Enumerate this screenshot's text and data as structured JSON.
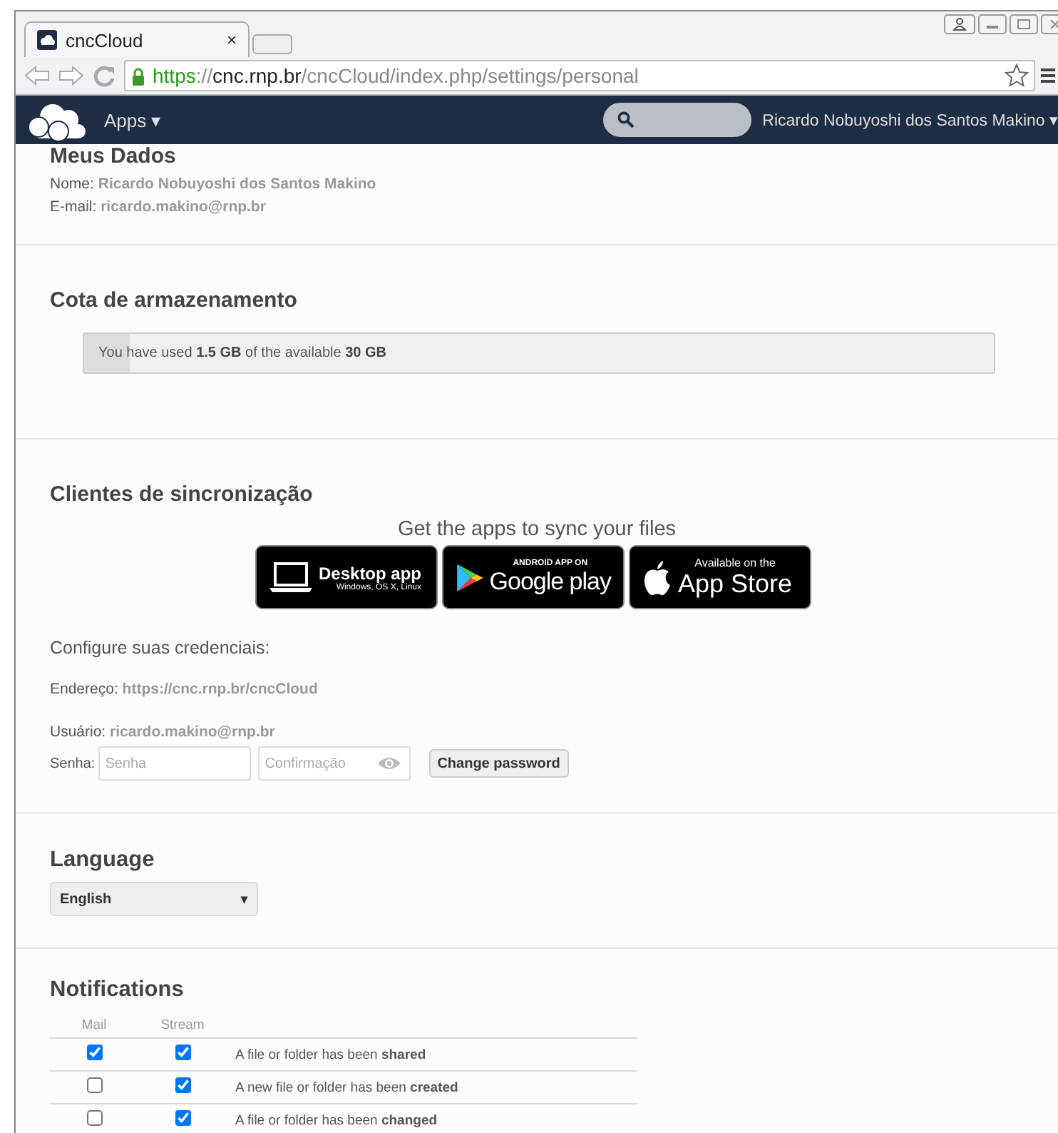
{
  "browser": {
    "tab": {
      "title": "cncCloud",
      "close": "×"
    },
    "url": {
      "scheme": "https",
      "separator": "://",
      "host": "cnc.rnp.br",
      "path": "/cncCloud/index.php/settings/personal"
    }
  },
  "header": {
    "apps": "Apps ▾",
    "user": "Ricardo Nobuyoshi dos Santos Makino ▾"
  },
  "personal": {
    "title": "Meus Dados",
    "fields": [
      {
        "label": "Nome:",
        "value": "Ricardo Nobuyoshi dos Santos Makino"
      },
      {
        "label": "E-mail:",
        "value": "ricardo.makino@rnp.br"
      }
    ]
  },
  "quota": {
    "title": "Cota de armazenamento",
    "text": "You have used **1.5 GB** of the available **30 GB**",
    "level": 0.05
  },
  "sync": {
    "title": "Clientes de sincronização",
    "subtitle": "Get the apps to sync your files",
    "badges": [
      {
        "kind": "desktop",
        "line1": "Desktop app",
        "line2": "Windows, OS X, Linux"
      },
      {
        "kind": "android",
        "line1": "ANDROID APP ON",
        "line2": "Google play"
      },
      {
        "kind": "ios",
        "line1": "Available on the",
        "line2": "App Store"
      }
    ],
    "credentials_title": "Configure suas credenciais:",
    "address": {
      "label": "Endereço:",
      "value": "https://cnc.rnp.br/cncCloud"
    },
    "user": {
      "label": "Usuário:",
      "value": "ricardo.makino@rnp.br"
    },
    "password": {
      "label": "Senha:",
      "placeholder": "Senha",
      "confirm_placeholder": "Confirmação",
      "button": "Change password"
    }
  },
  "language": {
    "title": "Language",
    "value": "English",
    "caret": "▾"
  },
  "notifications": {
    "title": "Notifications",
    "columns": [
      "Mail",
      "Stream"
    ],
    "rows": [
      {
        "mail": true,
        "stream": true,
        "text": "A file or folder has been **shared**"
      },
      {
        "mail": false,
        "stream": true,
        "text": "A new file or folder has been **created**"
      },
      {
        "mail": false,
        "stream": true,
        "text": "A file or folder has been **changed**"
      }
    ]
  }
}
